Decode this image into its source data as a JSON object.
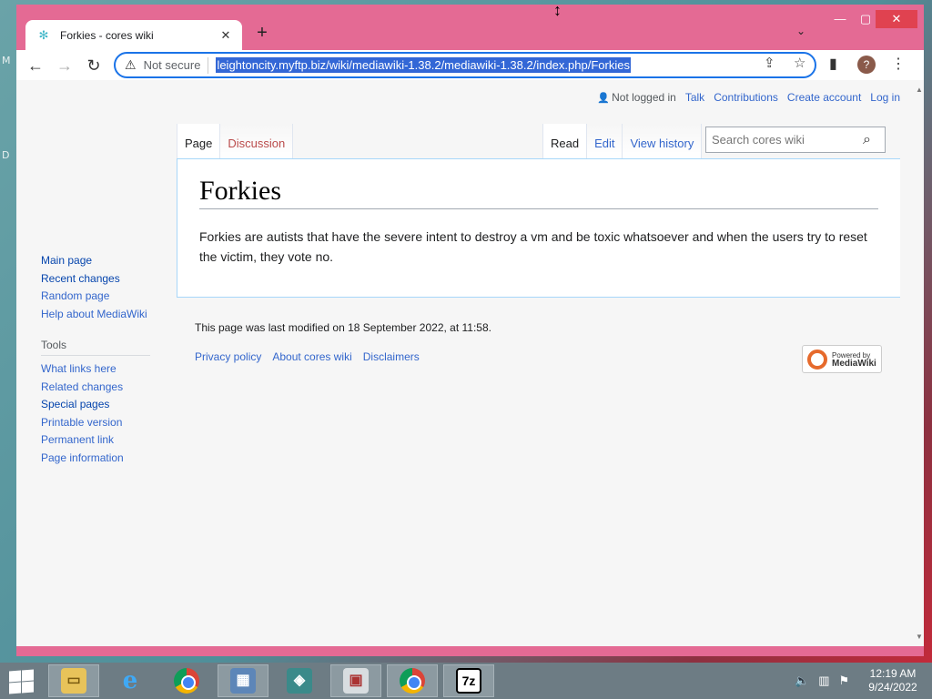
{
  "desktop": {
    "letters": [
      "M",
      "D"
    ]
  },
  "browser": {
    "tab_title": "Forkies - cores wiki",
    "new_tab": "+",
    "security_label": "Not secure",
    "url": "leightoncity.myftp.biz/wiki/mediawiki-1.38.2/mediawiki-1.38.2/index.php/Forkies",
    "profile_initial": "?"
  },
  "wiki": {
    "personal": {
      "not_logged_in": "Not logged in",
      "talk": "Talk",
      "contributions": "Contributions",
      "create_account": "Create account",
      "log_in": "Log in"
    },
    "namespaces": {
      "page": "Page",
      "discussion": "Discussion"
    },
    "views": {
      "read": "Read",
      "edit": "Edit",
      "history": "View history"
    },
    "search_placeholder": "Search cores wiki",
    "title": "Forkies",
    "body": "Forkies are autists that have the severe intent to destroy a vm and be toxic whatsoever and when the users try to reset the victim, they vote no.",
    "navigation": [
      "Main page",
      "Recent changes",
      "Random page",
      "Help about MediaWiki"
    ],
    "tools_heading": "Tools",
    "tools": [
      "What links here",
      "Related changes",
      "Special pages",
      "Printable version",
      "Permanent link",
      "Page information"
    ],
    "last_modified": "This page was last modified on 18 September 2022, at 11:58.",
    "footer_links": [
      "Privacy policy",
      "About cores wiki",
      "Disclaimers"
    ],
    "powered_by": {
      "line1": "Powered by",
      "line2": "MediaWiki"
    }
  },
  "taskbar": {
    "clock_time": "12:19 AM",
    "clock_date": "9/24/2022",
    "sevenzip_label": "7z"
  },
  "colors": {
    "window_frame": "#e46a94",
    "link": "#3366cc",
    "taskbar": "#6d7c84"
  }
}
